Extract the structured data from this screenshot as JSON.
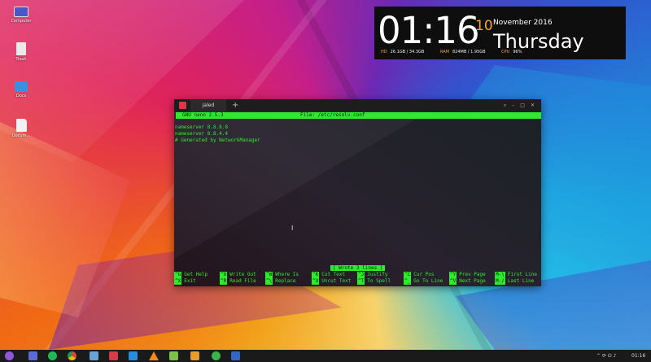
{
  "desktop": {
    "icons": [
      {
        "label": "Computer",
        "icon": "computer-icon",
        "color": "#4a55c8"
      },
      {
        "label": "Trash",
        "icon": "trash-icon",
        "color": "#e9e9e9"
      },
      {
        "label": "Docs",
        "icon": "folder-icon",
        "color": "#3a8fe0"
      },
      {
        "label": "Docum...",
        "icon": "document-icon",
        "color": "#f2f2f2"
      }
    ]
  },
  "clock": {
    "time": "01:16",
    "day": "10",
    "month_year": "November 2016",
    "weekday": "Thursday",
    "hd_label": "HD",
    "hd_value": "26.1GB / 34.3GB",
    "ram_label": "RAM",
    "ram_value": "824MB / 1.95GB",
    "cpu_label": "CPU",
    "cpu_value": "96%",
    "accent": "#f6a623"
  },
  "terminal": {
    "tab_title": "jaled",
    "new_tab": "+",
    "nano_version": "GNU nano 2.5.3",
    "file_label": "File: /etc/resolv.conf",
    "lines": [
      "nameserver 8.8.8.8",
      "nameserver 8.8.4.4",
      "# Generated by NetworkManager"
    ],
    "status_message": "[ Wrote 3 lines ]",
    "shortcuts": [
      {
        "key": "^G",
        "label": "Get Help"
      },
      {
        "key": "^O",
        "label": "Write Out"
      },
      {
        "key": "^W",
        "label": "Where Is"
      },
      {
        "key": "^K",
        "label": "Cut Text"
      },
      {
        "key": "^J",
        "label": "Justify"
      },
      {
        "key": "^C",
        "label": "Cur Pos"
      },
      {
        "key": "^Y",
        "label": "Prev Page"
      },
      {
        "key": "M-\\",
        "label": "First Line"
      },
      {
        "key": "^X",
        "label": "Exit"
      },
      {
        "key": "^R",
        "label": "Read File"
      },
      {
        "key": "^\\",
        "label": "Replace"
      },
      {
        "key": "^U",
        "label": "Uncut Text"
      },
      {
        "key": "^T",
        "label": "To Spell"
      },
      {
        "key": "^_",
        "label": "Go To Line"
      },
      {
        "key": "^V",
        "label": "Next Page"
      },
      {
        "key": "M-/",
        "label": "Last Line"
      }
    ],
    "accent": "#2dea2d"
  },
  "taskbar": {
    "apps": [
      {
        "icon": "launcher-icon",
        "color": "#8e56d8"
      },
      {
        "icon": "files-icon",
        "color": "#5b6bd6"
      },
      {
        "icon": "spotify-icon",
        "color": "#1db954"
      },
      {
        "icon": "chrome-icon",
        "color": "#e8b530"
      },
      {
        "icon": "store-icon",
        "color": "#6aa3d8"
      },
      {
        "icon": "terminal-icon",
        "color": "#d83a4a"
      },
      {
        "icon": "flag-icon",
        "color": "#2a8ce0"
      },
      {
        "icon": "vlc-icon",
        "color": "#f08a1c"
      },
      {
        "icon": "android-icon",
        "color": "#7cc14a"
      },
      {
        "icon": "archive-icon",
        "color": "#e89c2c"
      },
      {
        "icon": "recorder-icon",
        "color": "#39b54a"
      },
      {
        "icon": "writer-icon",
        "color": "#3565c5"
      }
    ],
    "time": "01:16"
  }
}
